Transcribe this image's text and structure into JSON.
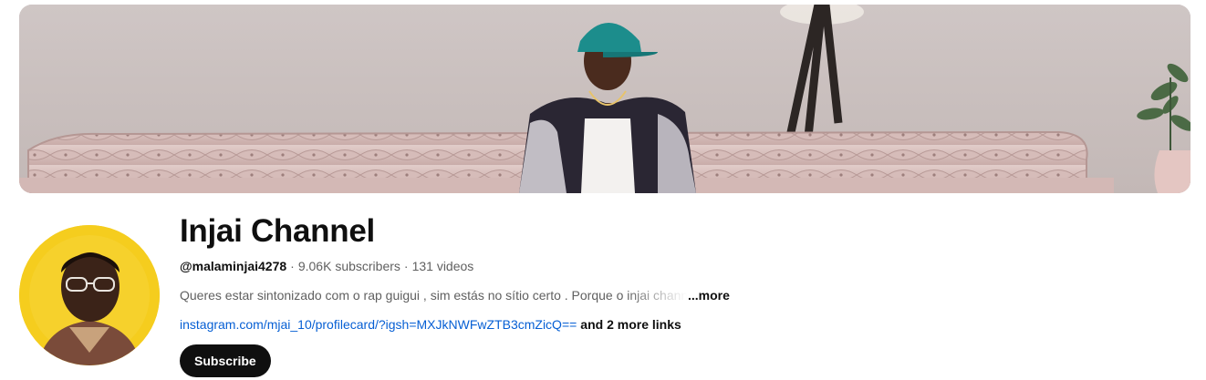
{
  "channel": {
    "title": "Injai Channel",
    "handle": "@malaminjai4278",
    "separator": "·",
    "subscribers": "9.06K subscribers",
    "videos": "131 videos",
    "description": "Queres estar sintonizado com o rap guigui , sim estás no sítio certo . Porque o injai chann",
    "more_label": "...more",
    "link_text": "instagram.com/mjai_10/profilecard/?igsh=MXJkNWFwZTB3cmZicQ==",
    "more_links_label": "and 2 more links",
    "subscribe_label": "Subscribe"
  },
  "colors": {
    "link": "#065fd4",
    "subscribe_bg": "#0f0f0f",
    "avatar_bg": "#f5cd1e",
    "banner_wall": "#c9bfbe",
    "sofa": "#d8bfbd"
  },
  "icons": {
    "banner": "channel-banner-image",
    "avatar": "channel-avatar-image"
  }
}
